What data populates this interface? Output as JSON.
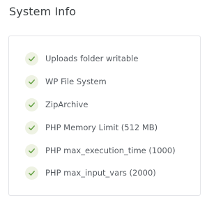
{
  "title": "System Info",
  "colors": {
    "check_stroke": "#5f9e3d",
    "check_bg": "#eef2e3"
  },
  "checks": [
    {
      "label": "Uploads folder writable",
      "icon": "check-icon"
    },
    {
      "label": "WP File System",
      "icon": "check-icon"
    },
    {
      "label": "ZipArchive",
      "icon": "check-icon"
    },
    {
      "label": "PHP Memory Limit (512 MB)",
      "icon": "check-icon"
    },
    {
      "label": "PHP max_execution_time (1000)",
      "icon": "check-icon"
    },
    {
      "label": "PHP max_input_vars (2000)",
      "icon": "check-icon"
    }
  ]
}
